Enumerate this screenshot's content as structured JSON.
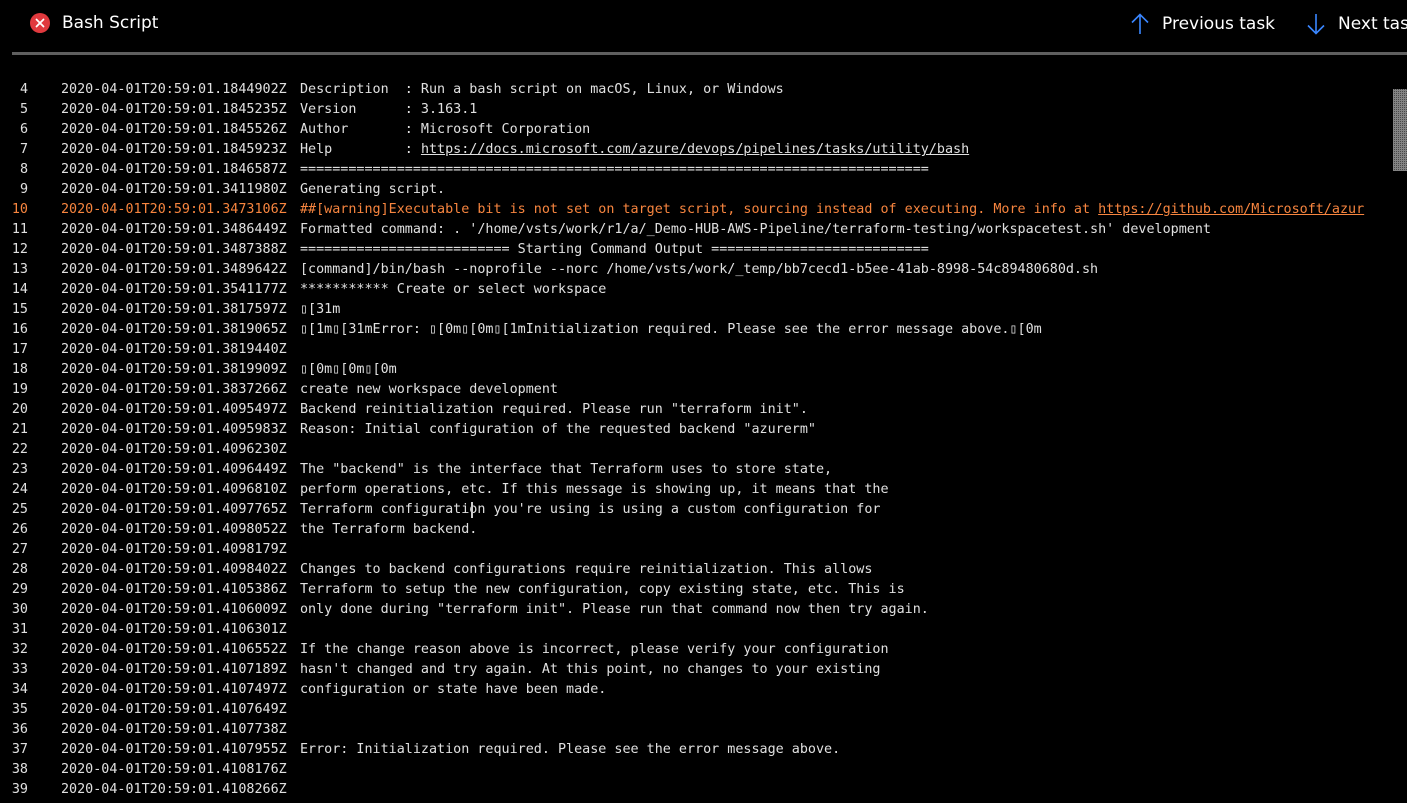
{
  "header": {
    "title": "Bash Script",
    "status_icon": "error-circle-icon",
    "status_color": "#e0393e",
    "prev_label": "Previous task",
    "next_label": "Next task",
    "accent": "#3a86ff"
  },
  "log": {
    "warning_color": "#f7853f",
    "lines": [
      {
        "n": "4",
        "ts": "2020-04-01T20:59:01.1844902Z",
        "msg": "Description  : Run a bash script on macOS, Linux, or Windows"
      },
      {
        "n": "5",
        "ts": "2020-04-01T20:59:01.1845235Z",
        "msg": "Version      : 3.163.1"
      },
      {
        "n": "6",
        "ts": "2020-04-01T20:59:01.1845526Z",
        "msg": "Author       : Microsoft Corporation"
      },
      {
        "n": "7",
        "ts": "2020-04-01T20:59:01.1845923Z",
        "msg": "Help         : ",
        "link": "https://docs.microsoft.com/azure/devops/pipelines/tasks/utility/bash"
      },
      {
        "n": "8",
        "ts": "2020-04-01T20:59:01.1846587Z",
        "msg": "=============================================================================="
      },
      {
        "n": "9",
        "ts": "2020-04-01T20:59:01.3411980Z",
        "msg": "Generating script."
      },
      {
        "n": "10",
        "ts": "2020-04-01T20:59:01.3473106Z",
        "msg": "##[warning]Executable bit is not set on target script, sourcing instead of executing. More info at ",
        "link": "https://github.com/Microsoft/azur",
        "warning": true
      },
      {
        "n": "11",
        "ts": "2020-04-01T20:59:01.3486449Z",
        "msg": "Formatted command: . '/home/vsts/work/r1/a/_Demo-HUB-AWS-Pipeline/terraform-testing/workspacetest.sh' development"
      },
      {
        "n": "12",
        "ts": "2020-04-01T20:59:01.3487388Z",
        "msg": "========================== Starting Command Output ==========================="
      },
      {
        "n": "13",
        "ts": "2020-04-01T20:59:01.3489642Z",
        "msg": "[command]/bin/bash --noprofile --norc /home/vsts/work/_temp/bb7cecd1-b5ee-41ab-8998-54c89480680d.sh"
      },
      {
        "n": "14",
        "ts": "2020-04-01T20:59:01.3541177Z",
        "msg": "*********** Create or select workspace"
      },
      {
        "n": "15",
        "ts": "2020-04-01T20:59:01.3817597Z",
        "msg": "▯[31m"
      },
      {
        "n": "16",
        "ts": "2020-04-01T20:59:01.3819065Z",
        "msg": "▯[1m▯[31mError: ▯[0m▯[0m▯[1mInitialization required. Please see the error message above.▯[0m"
      },
      {
        "n": "17",
        "ts": "2020-04-01T20:59:01.3819440Z",
        "msg": ""
      },
      {
        "n": "18",
        "ts": "2020-04-01T20:59:01.3819909Z",
        "msg": "▯[0m▯[0m▯[0m"
      },
      {
        "n": "19",
        "ts": "2020-04-01T20:59:01.3837266Z",
        "msg": "create new workspace development"
      },
      {
        "n": "20",
        "ts": "2020-04-01T20:59:01.4095497Z",
        "msg": "Backend reinitialization required. Please run \"terraform init\"."
      },
      {
        "n": "21",
        "ts": "2020-04-01T20:59:01.4095983Z",
        "msg": "Reason: Initial configuration of the requested backend \"azurerm\""
      },
      {
        "n": "22",
        "ts": "2020-04-01T20:59:01.4096230Z",
        "msg": ""
      },
      {
        "n": "23",
        "ts": "2020-04-01T20:59:01.4096449Z",
        "msg": "The \"backend\" is the interface that Terraform uses to store state,"
      },
      {
        "n": "24",
        "ts": "2020-04-01T20:59:01.4096810Z",
        "msg": "perform operations, etc. If this message is showing up, it means that the"
      },
      {
        "n": "25",
        "ts": "2020-04-01T20:59:01.4097765Z",
        "msg": "Terraform configuration you're using is using a custom configuration for"
      },
      {
        "n": "26",
        "ts": "2020-04-01T20:59:01.4098052Z",
        "msg": "the Terraform backend."
      },
      {
        "n": "27",
        "ts": "2020-04-01T20:59:01.4098179Z",
        "msg": ""
      },
      {
        "n": "28",
        "ts": "2020-04-01T20:59:01.4098402Z",
        "msg": "Changes to backend configurations require reinitialization. This allows"
      },
      {
        "n": "29",
        "ts": "2020-04-01T20:59:01.4105386Z",
        "msg": "Terraform to setup the new configuration, copy existing state, etc. This is"
      },
      {
        "n": "30",
        "ts": "2020-04-01T20:59:01.4106009Z",
        "msg": "only done during \"terraform init\". Please run that command now then try again."
      },
      {
        "n": "31",
        "ts": "2020-04-01T20:59:01.4106301Z",
        "msg": ""
      },
      {
        "n": "32",
        "ts": "2020-04-01T20:59:01.4106552Z",
        "msg": "If the change reason above is incorrect, please verify your configuration"
      },
      {
        "n": "33",
        "ts": "2020-04-01T20:59:01.4107189Z",
        "msg": "hasn't changed and try again. At this point, no changes to your existing"
      },
      {
        "n": "34",
        "ts": "2020-04-01T20:59:01.4107497Z",
        "msg": "configuration or state have been made."
      },
      {
        "n": "35",
        "ts": "2020-04-01T20:59:01.4107649Z",
        "msg": ""
      },
      {
        "n": "36",
        "ts": "2020-04-01T20:59:01.4107738Z",
        "msg": ""
      },
      {
        "n": "37",
        "ts": "2020-04-01T20:59:01.4107955Z",
        "msg": "Error: Initialization required. Please see the error message above."
      },
      {
        "n": "38",
        "ts": "2020-04-01T20:59:01.4108176Z",
        "msg": ""
      },
      {
        "n": "39",
        "ts": "2020-04-01T20:59:01.4108266Z",
        "msg": ""
      }
    ]
  }
}
